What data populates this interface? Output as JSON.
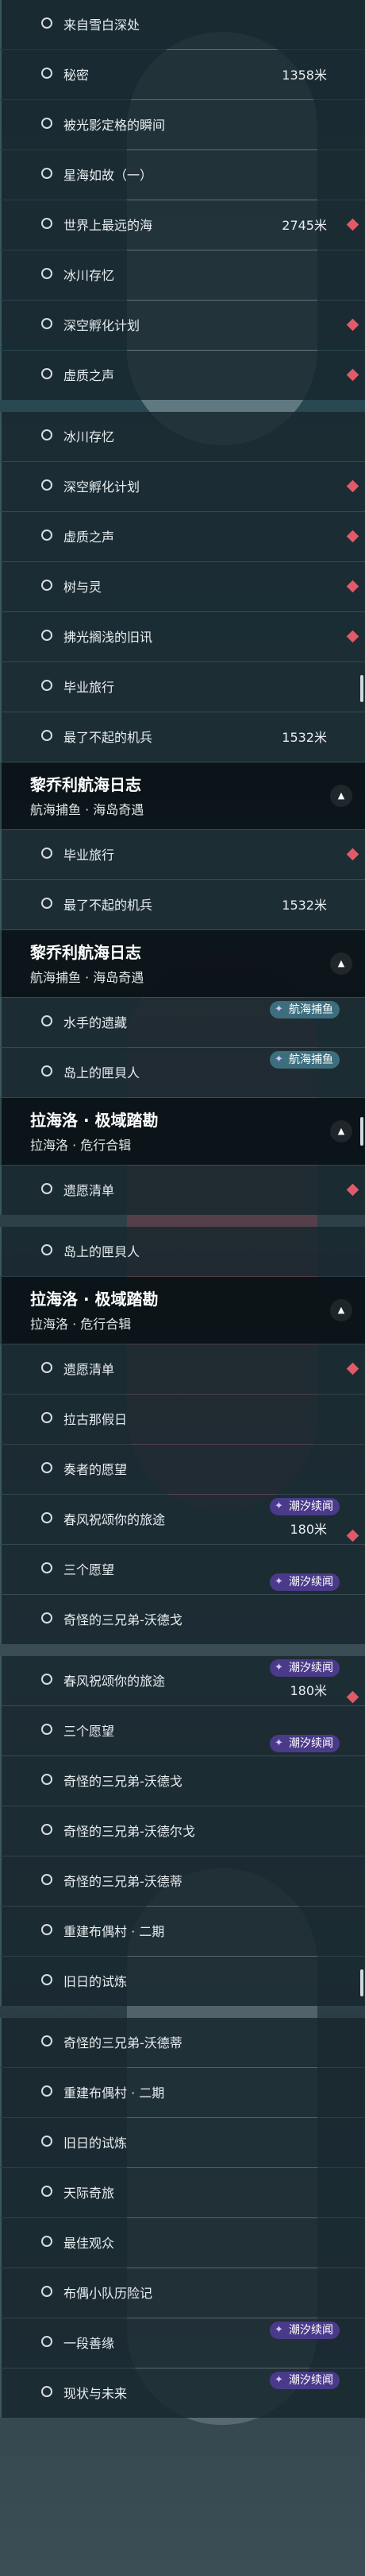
{
  "colors": {
    "marker": "#e05b6a",
    "badge": "#4a3a8a",
    "badge_teal": "#3d6e7e"
  },
  "rows": [
    {
      "type": "item",
      "label": "来自雪白深处",
      "dist": ""
    },
    {
      "type": "item",
      "label": "秘密",
      "dist": "1358米"
    },
    {
      "type": "item",
      "label": "被光影定格的瞬间",
      "dist": ""
    },
    {
      "type": "item",
      "label": "星海如故（一）",
      "dist": ""
    },
    {
      "type": "item",
      "label": "世界上最远的海",
      "dist": "2745米",
      "marker": true
    },
    {
      "type": "item",
      "label": "冰川存忆",
      "dist": ""
    },
    {
      "type": "item",
      "label": "深空孵化计划",
      "dist": "",
      "marker": true
    },
    {
      "type": "item",
      "label": "虚质之声",
      "dist": "",
      "marker": true
    },
    {
      "type": "gap"
    },
    {
      "type": "item",
      "label": "冰川存忆",
      "dist": ""
    },
    {
      "type": "item",
      "label": "深空孵化计划",
      "dist": "",
      "marker": true
    },
    {
      "type": "item",
      "label": "虚质之声",
      "dist": "",
      "marker": true
    },
    {
      "type": "item",
      "label": "树与灵",
      "dist": "",
      "marker": true
    },
    {
      "type": "item",
      "label": "拂光搁浅的旧讯",
      "dist": "",
      "marker": true
    },
    {
      "type": "item",
      "label": "毕业旅行",
      "dist": "",
      "scroll": true
    },
    {
      "type": "item",
      "label": "最了不起的机兵",
      "dist": "1532米"
    },
    {
      "type": "header",
      "title": "黎乔利航海日志",
      "sub": "航海捕鱼 · 海岛奇遇"
    },
    {
      "type": "item",
      "label": "毕业旅行",
      "dist": "",
      "marker": true
    },
    {
      "type": "item",
      "label": "最了不起的机兵",
      "dist": "1532米"
    },
    {
      "type": "header",
      "title": "黎乔利航海日志",
      "sub": "航海捕鱼 · 海岛奇遇"
    },
    {
      "type": "item",
      "label": "水手的遗藏",
      "dist": "",
      "badge": "航海捕鱼",
      "teal": true
    },
    {
      "type": "item",
      "label": "岛上的匣貝人",
      "dist": "",
      "badge": "航海捕鱼",
      "teal": true
    },
    {
      "type": "header",
      "title": "拉海洛 · 极域踏勘",
      "sub": "拉海洛 · 危行合辑",
      "scroll": true
    },
    {
      "type": "item",
      "label": "遗愿清单",
      "dist": "",
      "marker": true
    },
    {
      "type": "gap"
    },
    {
      "type": "item",
      "label": "岛上的匣貝人",
      "dist": ""
    },
    {
      "type": "header",
      "title": "拉海洛 · 极域踏勘",
      "sub": "拉海洛 · 危行合辑"
    },
    {
      "type": "item",
      "label": "遗愿清单",
      "dist": "",
      "marker": true
    },
    {
      "type": "item",
      "label": "拉古那假日",
      "dist": ""
    },
    {
      "type": "item",
      "label": "奏者的愿望",
      "dist": ""
    },
    {
      "type": "item",
      "label": "春风祝颂你的旅途",
      "dist": "180米",
      "badge": "潮汐续闻",
      "marker": true
    },
    {
      "type": "item",
      "label": "三个愿望",
      "dist": "",
      "badge": "潮汐续闻",
      "lower": true
    },
    {
      "type": "item",
      "label": "奇怪的三兄弟-沃德戈",
      "dist": ""
    },
    {
      "type": "gap"
    },
    {
      "type": "item",
      "label": "春风祝颂你的旅途",
      "dist": "180米",
      "badge": "潮汐续闻",
      "marker": true
    },
    {
      "type": "item",
      "label": "三个愿望",
      "dist": "",
      "badge": "潮汐续闻",
      "lower": true
    },
    {
      "type": "item",
      "label": "奇怪的三兄弟-沃德戈",
      "dist": ""
    },
    {
      "type": "item",
      "label": "奇怪的三兄弟-沃德尔戈",
      "dist": ""
    },
    {
      "type": "item",
      "label": "奇怪的三兄弟-沃德蒂",
      "dist": ""
    },
    {
      "type": "item",
      "label": "重建布偶村 · 二期",
      "dist": ""
    },
    {
      "type": "item",
      "label": "旧日的试炼",
      "dist": "",
      "scroll": true
    },
    {
      "type": "gap"
    },
    {
      "type": "item",
      "label": "奇怪的三兄弟-沃德蒂",
      "dist": ""
    },
    {
      "type": "item",
      "label": "重建布偶村 · 二期",
      "dist": ""
    },
    {
      "type": "item",
      "label": "旧日的试炼",
      "dist": ""
    },
    {
      "type": "item",
      "label": "天际奇旅",
      "dist": ""
    },
    {
      "type": "item",
      "label": "最佳观众",
      "dist": ""
    },
    {
      "type": "item",
      "label": "布偶小队历险记",
      "dist": ""
    },
    {
      "type": "item",
      "label": "一段善缘",
      "dist": "",
      "badge": "潮汐续闻"
    },
    {
      "type": "item",
      "label": "现状与未来",
      "dist": "",
      "badge": "潮汐续闻"
    }
  ]
}
